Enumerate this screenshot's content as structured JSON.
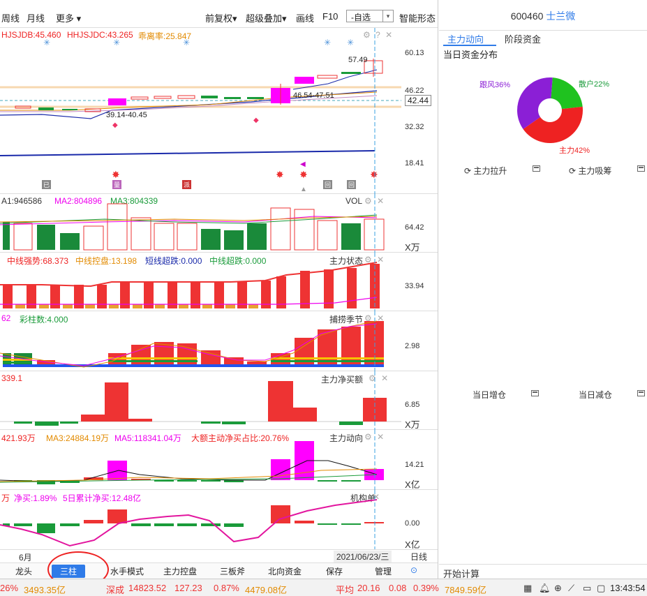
{
  "toolbar": {
    "items": [
      "周线",
      "月线",
      "更多 ▾",
      "前复权▾",
      "超级叠加▾",
      "画线",
      "F10",
      "智能形态"
    ],
    "search_value": "-自选",
    "search_dropdown": "▾"
  },
  "kline": {
    "labels": [
      "HJSJDB:45.460",
      "HHJSJDC:43.265",
      "乖离率:25.847"
    ],
    "colors": [
      "#e22",
      "#e22",
      "#e28a00"
    ],
    "y_ticks": [
      "60.13",
      "46.22",
      "32.32",
      "18.41"
    ],
    "current_price": "42.44",
    "price_annotations": [
      "57.49",
      "46.54-47.51",
      "39.14-40.45"
    ],
    "signal_badges": [
      "已",
      "量",
      "派",
      "回",
      "回"
    ]
  },
  "vol": {
    "labels": [
      "A1:946586",
      "MA2:804896",
      "MA3:804339"
    ],
    "name": "VOL",
    "y_tick": "64.42",
    "unit": "X万"
  },
  "zhuli_state": {
    "labels": [
      "中线强势:68.373",
      "中线控盘:13.198",
      "短线超跌:0.000",
      "中线超跌:0.000"
    ],
    "name": "主力状态",
    "y_tick": "33.94"
  },
  "capture": {
    "labels": [
      "62",
      "彩柱数:4.000"
    ],
    "name": "捕捞季节",
    "y_tick": "2.98"
  },
  "net_buy": {
    "labels": [
      "339.1"
    ],
    "name": "主力净买额",
    "y_tick": "6.85",
    "unit": "X万"
  },
  "zhuli_dir": {
    "labels": [
      "421.93万",
      "MA3:24884.19万",
      "MA5:118341.04万",
      "大额主动净买占比:20.76%"
    ],
    "name": "主力动向",
    "y_tick": "14.21",
    "unit": "X亿"
  },
  "inst": {
    "labels": [
      "万",
      "净买:1.89%",
      "5日累计净买:12.48亿"
    ],
    "name": "机构单",
    "y_tick": "0.00",
    "unit": "X亿"
  },
  "date_bar": {
    "month": "6月",
    "date": "2021/06/23/三",
    "period": "日线"
  },
  "bottom_tabs": [
    "龙头",
    "三柱",
    "水手模式",
    "主力控盘",
    "三板斧",
    "北向资金",
    "保存",
    "管理"
  ],
  "bottom_active": "三柱",
  "right": {
    "code": "600460",
    "name": "士兰微",
    "tabs": [
      "主力动向",
      "阶段资金"
    ],
    "subtitle": "当日资金分布",
    "pie": [
      {
        "label": "跟风36%",
        "value": 36,
        "color": "#8b1fd6"
      },
      {
        "label": "散户22%",
        "value": 22,
        "color": "#1fc21f"
      },
      {
        "label": "主力42%",
        "value": 42,
        "color": "#ee2222"
      }
    ],
    "sections": [
      "主力拉升",
      "主力吸筹",
      "当日增仓",
      "当日减仓"
    ],
    "bottom_label": "开始计算"
  },
  "status": {
    "sh_pct": "26%",
    "sh_amt": "3493.35亿",
    "sz_name": "深成",
    "sz_val": "14823.52",
    "sz_chg": "127.23",
    "sz_pct": "0.87%",
    "sz_amt": "4479.08亿",
    "avg_name": "平均",
    "avg_val": "20.16",
    "avg_chg": "0.08",
    "avg_pct": "0.39%",
    "avg_amt": "7849.59亿",
    "time": "13:43:54"
  }
}
